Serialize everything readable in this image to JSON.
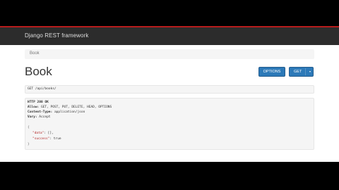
{
  "navbar": {
    "brand": "Django REST framework"
  },
  "breadcrumb": {
    "item": "Book"
  },
  "page": {
    "title": "Book"
  },
  "buttons": {
    "options": "OPTIONS",
    "get": "GET",
    "get_caret": "▾"
  },
  "request": {
    "text": "GET /api/books/"
  },
  "response": {
    "status": "HTTP 200 OK",
    "allow_label": "Allow:",
    "allow_value": "GET, POST, PUT, DELETE, HEAD, OPTIONS",
    "content_type_label": "Content-Type:",
    "content_type_value": "application/json",
    "vary_label": "Vary:",
    "vary_value": "Accept",
    "open_brace": "{",
    "data_key": "\"data\"",
    "data_value": ": [],",
    "success_key": "\"success\"",
    "success_value": ": true",
    "close_brace": "}"
  },
  "colors": {
    "navbar_bg": "#2c2c2c",
    "navbar_accent": "#b71c1c",
    "button_primary": "#2c79b8"
  }
}
